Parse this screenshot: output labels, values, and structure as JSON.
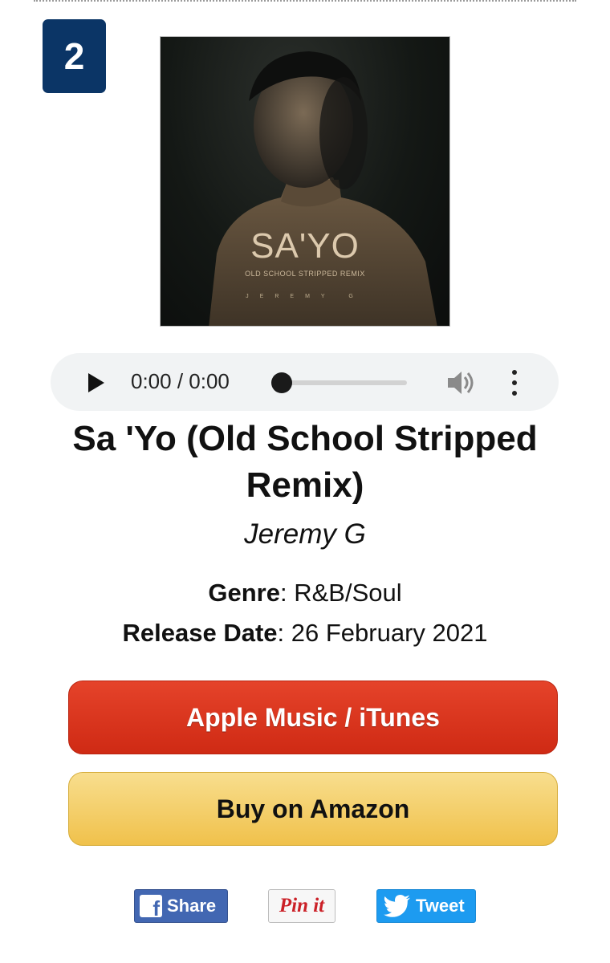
{
  "rank": "2",
  "cover": {
    "title": "SA'YO",
    "subtitle": "OLD SCHOOL STRIPPED REMIX",
    "artist": "JEREMY G"
  },
  "player": {
    "time": "0:00 / 0:00",
    "progress": 0,
    "icons": [
      "play-icon",
      "volume-icon",
      "more-options-icon"
    ]
  },
  "song": {
    "title": "Sa 'Yo (Old School Stripped Remix)",
    "artist": "Jeremy G"
  },
  "meta": {
    "genre_label": "Genre",
    "genre_value": ": R&B/Soul",
    "release_label": "Release Date",
    "release_value": ": 26 February 2021"
  },
  "buttons": {
    "apple": "Apple Music / iTunes",
    "amazon": "Buy on Amazon"
  },
  "share": {
    "facebook": "Share",
    "pinterest": "Pin it",
    "twitter": "Tweet"
  },
  "colors": {
    "badge": "#0b3566",
    "apple_button": "#d9351c",
    "amazon_button": "#f0c14b",
    "facebook": "#4267b2",
    "twitter": "#1d9bf0",
    "pinterest": "#cb2027"
  }
}
